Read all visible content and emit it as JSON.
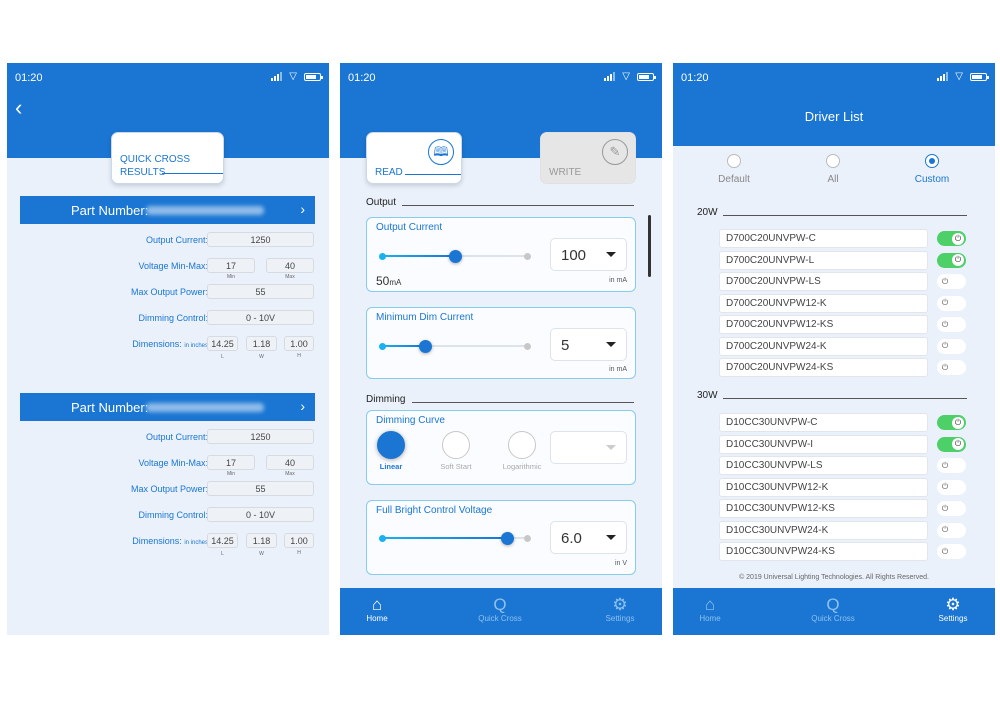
{
  "status_bar": {
    "time": "01:20"
  },
  "screen1": {
    "badge": {
      "line1": "QUICK CROSS",
      "line2": "RESULTS"
    },
    "results": [
      {
        "part_number_label": "Part Number:",
        "output_current_label": "Output Current:",
        "output_current": "1250",
        "voltage_label": "Voltage Min-Max:",
        "voltage_min": "17",
        "voltage_max": "40",
        "min_label": "Min",
        "max_label": "Max",
        "max_power_label": "Max Output Power:",
        "max_power": "55",
        "dimming_label": "Dimming Control:",
        "dimming": "0 - 10V",
        "dimensions_label": "Dimensions:",
        "dimensions_unit": "in inches",
        "length": "14.25",
        "width": "1.18",
        "height": "1.00",
        "l_label": "L",
        "w_label": "W",
        "h_label": "H"
      },
      {
        "part_number_label": "Part Number:",
        "output_current_label": "Output Current:",
        "output_current": "1250",
        "voltage_label": "Voltage Min-Max:",
        "voltage_min": "17",
        "voltage_max": "40",
        "min_label": "Min",
        "max_label": "Max",
        "max_power_label": "Max Output Power:",
        "max_power": "55",
        "dimming_label": "Dimming Control:",
        "dimming": "0 - 10V",
        "dimensions_label": "Dimensions:",
        "dimensions_unit": "in inches",
        "length": "14.25",
        "width": "1.18",
        "height": "1.00",
        "l_label": "L",
        "w_label": "W",
        "h_label": "H"
      }
    ]
  },
  "screen2": {
    "read_label": "READ",
    "write_label": "WRITE",
    "output_section": "Output",
    "output_current": {
      "title": "Output Current",
      "value": "100",
      "min_label": "50",
      "min_unit": "mA",
      "unit": "in mA",
      "slider_fraction": 0.5
    },
    "min_dim_current": {
      "title": "Minimum Dim Current",
      "value": "5",
      "unit": "in mA",
      "slider_fraction": 0.3
    },
    "dimming_section": "Dimming",
    "dimming_curve": {
      "title": "Dimming Curve",
      "options": [
        "Linear",
        "Soft Start",
        "Logarithmic"
      ],
      "selected": "Linear",
      "dropdown_value": ""
    },
    "full_bright": {
      "title": "Full Bright Control Voltage",
      "value": "6.0",
      "unit": "in V",
      "slider_fraction": 0.85
    }
  },
  "screen3": {
    "title": "Driver List",
    "modes": [
      "Default",
      "All",
      "Custom"
    ],
    "selected_mode": "Custom",
    "groups": [
      {
        "label": "20W",
        "drivers": [
          {
            "name": "D700C20UNVPW-C",
            "on": true
          },
          {
            "name": "D700C20UNVPW-L",
            "on": true
          },
          {
            "name": "D700C20UNVPW-LS",
            "on": false
          },
          {
            "name": "D700C20UNVPW12-K",
            "on": false
          },
          {
            "name": "D700C20UNVPW12-KS",
            "on": false
          },
          {
            "name": "D700C20UNVPW24-K",
            "on": false
          },
          {
            "name": "D700C20UNVPW24-KS",
            "on": false
          }
        ]
      },
      {
        "label": "30W",
        "drivers": [
          {
            "name": "D10CC30UNVPW-C",
            "on": true
          },
          {
            "name": "D10CC30UNVPW-I",
            "on": true
          },
          {
            "name": "D10CC30UNVPW-LS",
            "on": false
          },
          {
            "name": "D10CC30UNVPW12-K",
            "on": false
          },
          {
            "name": "D10CC30UNVPW12-KS",
            "on": false
          },
          {
            "name": "D10CC30UNVPW24-K",
            "on": false
          },
          {
            "name": "D10CC30UNVPW24-KS",
            "on": false
          }
        ]
      }
    ],
    "copyright": "© 2019 Universal Lighting Technologies. All Rights Reserved."
  },
  "tabbar": {
    "home": "Home",
    "quick_cross": "Quick Cross",
    "settings": "Settings"
  },
  "colors": {
    "brand": "#1a76d2",
    "toggle_on": "#4cd067",
    "background": "#eaf1fb"
  }
}
